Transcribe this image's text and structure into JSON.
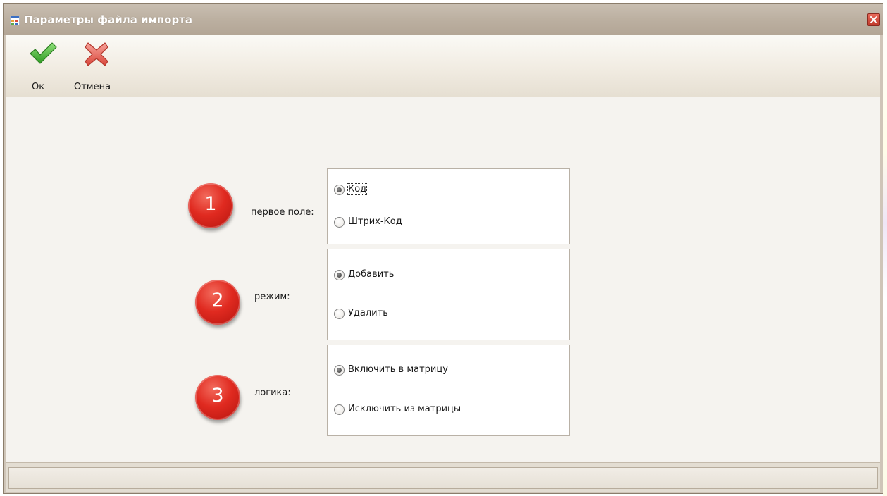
{
  "window": {
    "title": "Параметры файла импорта"
  },
  "toolbar": {
    "ok_label": "Ок",
    "cancel_label": "Отмена"
  },
  "groups": [
    {
      "badge": "1",
      "label": "первое поле:",
      "options": [
        {
          "label": "Код",
          "selected": true
        },
        {
          "label": "Штрих-Код",
          "selected": false
        }
      ]
    },
    {
      "badge": "2",
      "label": "режим:",
      "options": [
        {
          "label": "Добавить",
          "selected": true
        },
        {
          "label": "Удалить",
          "selected": false
        }
      ]
    },
    {
      "badge": "3",
      "label": "логика:",
      "options": [
        {
          "label": "Включить в матрицу",
          "selected": true
        },
        {
          "label": "Исключить из матрицы",
          "selected": false
        }
      ]
    }
  ],
  "colors": {
    "badge": "#e02a20",
    "titlebar": "#bcb0a1",
    "accept_icon": "#3aa52a",
    "cancel_icon": "#e0655a"
  }
}
